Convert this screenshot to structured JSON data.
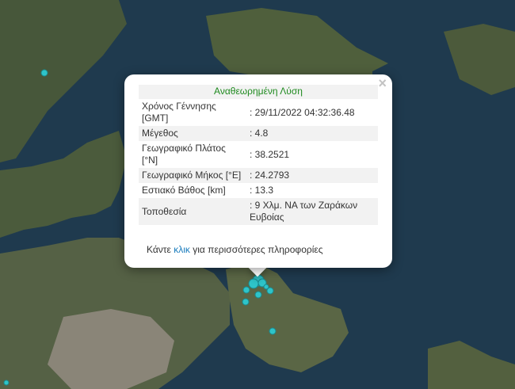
{
  "popup": {
    "close_symbol": "×",
    "header": "Αναθεωρημένη Λύση",
    "rows": [
      {
        "label": "Χρόνος Γέννησης [GMT]",
        "value": ": 29/11/2022 04:32:36.48"
      },
      {
        "label": "Μέγεθος",
        "value": ": 4.8"
      },
      {
        "label": "Γεωγραφικό Πλάτος [°N]",
        "value": ": 38.2521"
      },
      {
        "label": "Γεωγραφικό Μήκος [°E]",
        "value": ": 24.2793"
      },
      {
        "label": "Εστιακό Βάθος [km]",
        "value": ": 13.3"
      },
      {
        "label": "Τοποθεσία",
        "value": ": 9 Χλμ. ΝΑ των Ζαράκων Ευβοίας"
      }
    ],
    "more_prefix": "Κάντε ",
    "more_link": "κλικ",
    "more_suffix": " για περισσότερες πληροφορίες"
  },
  "map": {
    "sea_color": "#1f3a4e",
    "land_color": "#4a5a3a",
    "marker_color": "#2ec4c9",
    "markers_count_visible": 11
  },
  "icons": {
    "close": "close-icon",
    "marker": "earthquake-marker-icon"
  }
}
